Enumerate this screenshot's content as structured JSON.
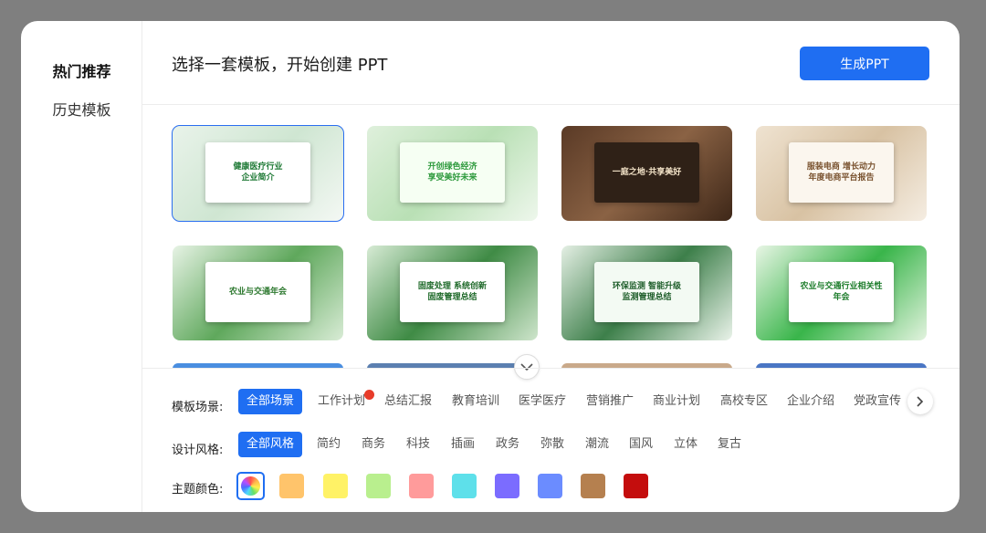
{
  "sidebar": {
    "items": [
      {
        "label": "热门推荐",
        "active": true
      },
      {
        "label": "历史模板",
        "active": false
      }
    ]
  },
  "header": {
    "title": "选择一套模板，开始创建 PPT",
    "generate_button": "生成PPT"
  },
  "templates": [
    {
      "lines": [
        "健康医疗行业",
        "企业简介"
      ],
      "theme": "green-white",
      "selected": true
    },
    {
      "lines": [
        "开创绿色经济",
        "享受美好未来"
      ],
      "theme": "green-light",
      "selected": false
    },
    {
      "lines": [
        "一庭之地·共享美好"
      ],
      "theme": "brown-dark",
      "selected": false
    },
    {
      "lines": [
        "服装电商 增长动力",
        "年度电商平台报告"
      ],
      "theme": "beige",
      "selected": false
    },
    {
      "lines": [
        "农业与交通年会"
      ],
      "theme": "green-leaf",
      "selected": false
    },
    {
      "lines": [
        "固废处理 系统创新",
        "固废管理总结"
      ],
      "theme": "green-recycle",
      "selected": false
    },
    {
      "lines": [
        "环保监测 智能升级",
        "监测管理总结"
      ],
      "theme": "green-earth",
      "selected": false
    },
    {
      "lines": [
        "农业与交通行业相关性",
        "年会"
      ],
      "theme": "green-bright",
      "selected": false
    }
  ],
  "filters": {
    "scene": {
      "label": "模板场景:",
      "options": [
        "全部场景",
        "工作计划",
        "总结汇报",
        "教育培训",
        "医学医疗",
        "营销推广",
        "商业计划",
        "高校专区",
        "企业介绍",
        "党政宣传"
      ],
      "selected": "全部场景",
      "hot": "工作计划"
    },
    "style": {
      "label": "设计风格:",
      "options": [
        "全部风格",
        "简约",
        "商务",
        "科技",
        "插画",
        "政务",
        "弥散",
        "潮流",
        "国风",
        "立体",
        "复古"
      ],
      "selected": "全部风格"
    },
    "color": {
      "label": "主题颜色:",
      "swatches": [
        "all",
        "#ffc46b",
        "#fff266",
        "#b9ef8e",
        "#ff9b9b",
        "#5ee0ea",
        "#7b6cff",
        "#6b8cff",
        "#b5804f",
        "#c40d0d"
      ]
    }
  },
  "icons": {
    "expand": "chevron-down-icon",
    "scroll": "chevron-right-icon",
    "hot": "fire-icon"
  }
}
